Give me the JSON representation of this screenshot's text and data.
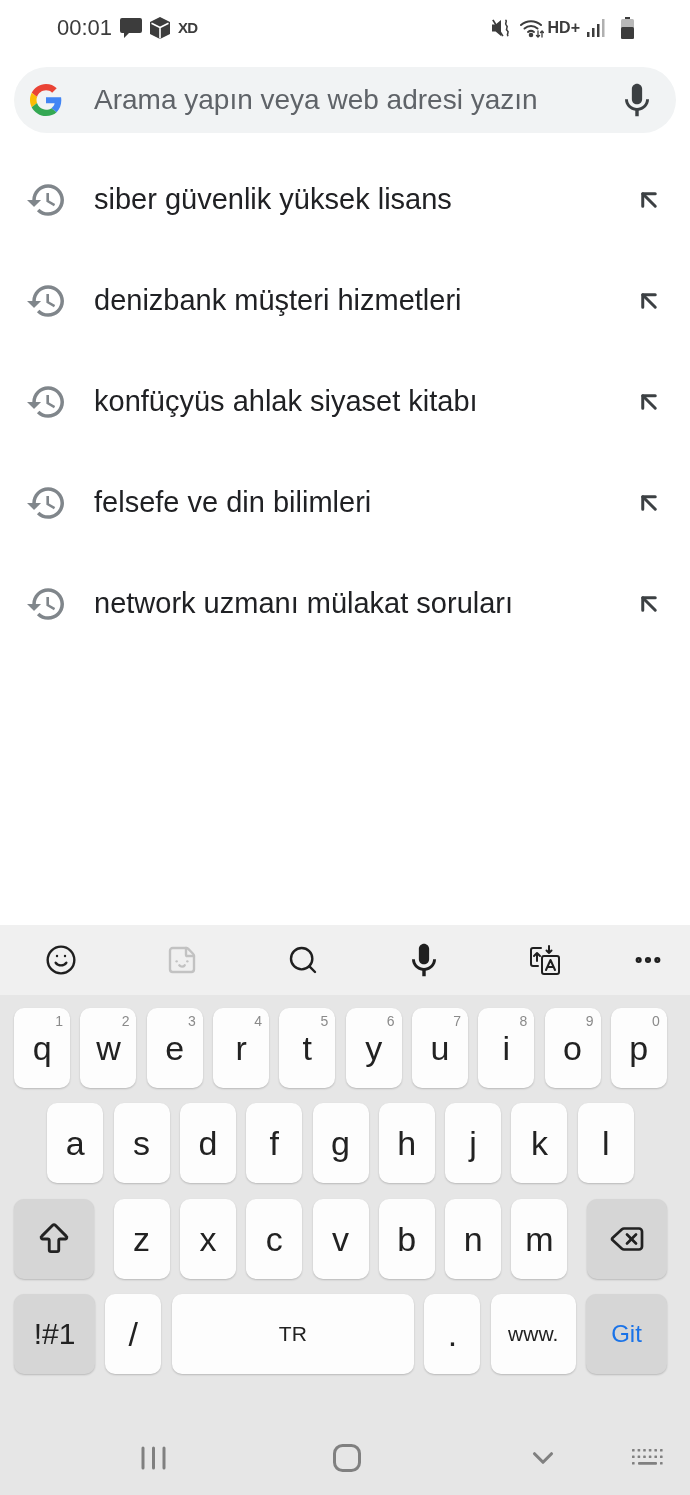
{
  "status_bar": {
    "time": "00:01",
    "notification_text": "XD",
    "network_type": "HD+"
  },
  "search_bar": {
    "placeholder": "Arama yapın veya web adresi yazın"
  },
  "suggestions": [
    {
      "text": "siber güvenlik yüksek lisans"
    },
    {
      "text": "denizbank müşteri hizmetleri"
    },
    {
      "text": "konfüçyüs ahlak siyaset kitabı"
    },
    {
      "text": "felsefe ve din bilimleri"
    },
    {
      "text": "network uzmanı mülakat soruları"
    }
  ],
  "keyboard": {
    "toolbar": [
      {
        "kind": "emoji",
        "disabled": false
      },
      {
        "kind": "sticker",
        "disabled": true
      },
      {
        "kind": "search",
        "disabled": false
      },
      {
        "kind": "voice",
        "disabled": false
      },
      {
        "kind": "translate",
        "disabled": false
      },
      {
        "kind": "more",
        "disabled": false
      }
    ],
    "rows": [
      {
        "keys": [
          {
            "kind": "char",
            "label": "q",
            "hint": "1"
          },
          {
            "kind": "char",
            "label": "w",
            "hint": "2"
          },
          {
            "kind": "char",
            "label": "e",
            "hint": "3"
          },
          {
            "kind": "char",
            "label": "r",
            "hint": "4"
          },
          {
            "kind": "char",
            "label": "t",
            "hint": "5"
          },
          {
            "kind": "char",
            "label": "y",
            "hint": "6"
          },
          {
            "kind": "char",
            "label": "u",
            "hint": "7"
          },
          {
            "kind": "char",
            "label": "i",
            "hint": "8"
          },
          {
            "kind": "char",
            "label": "o",
            "hint": "9"
          },
          {
            "kind": "char",
            "label": "p",
            "hint": "0"
          }
        ]
      },
      {
        "keys": [
          {
            "kind": "char",
            "label": "a"
          },
          {
            "kind": "char",
            "label": "s"
          },
          {
            "kind": "char",
            "label": "d"
          },
          {
            "kind": "char",
            "label": "f"
          },
          {
            "kind": "char",
            "label": "g"
          },
          {
            "kind": "char",
            "label": "h"
          },
          {
            "kind": "char",
            "label": "j"
          },
          {
            "kind": "char",
            "label": "k"
          },
          {
            "kind": "char",
            "label": "l"
          }
        ]
      },
      {
        "keys": [
          {
            "kind": "shift"
          },
          {
            "kind": "char",
            "label": "z"
          },
          {
            "kind": "char",
            "label": "x"
          },
          {
            "kind": "char",
            "label": "c"
          },
          {
            "kind": "char",
            "label": "v"
          },
          {
            "kind": "char",
            "label": "b"
          },
          {
            "kind": "char",
            "label": "n"
          },
          {
            "kind": "char",
            "label": "m"
          },
          {
            "kind": "backspace"
          }
        ]
      },
      {
        "keys": [
          {
            "kind": "symbols",
            "label": "!#1"
          },
          {
            "kind": "char",
            "label": "/"
          },
          {
            "kind": "space",
            "label": "TR"
          },
          {
            "kind": "char",
            "label": "."
          },
          {
            "kind": "domain",
            "label": "www."
          },
          {
            "kind": "action",
            "label": "Git"
          }
        ]
      }
    ]
  },
  "navigation_bar": [
    {
      "kind": "recents"
    },
    {
      "kind": "home"
    },
    {
      "kind": "back"
    },
    {
      "kind": "keyboard"
    }
  ]
}
